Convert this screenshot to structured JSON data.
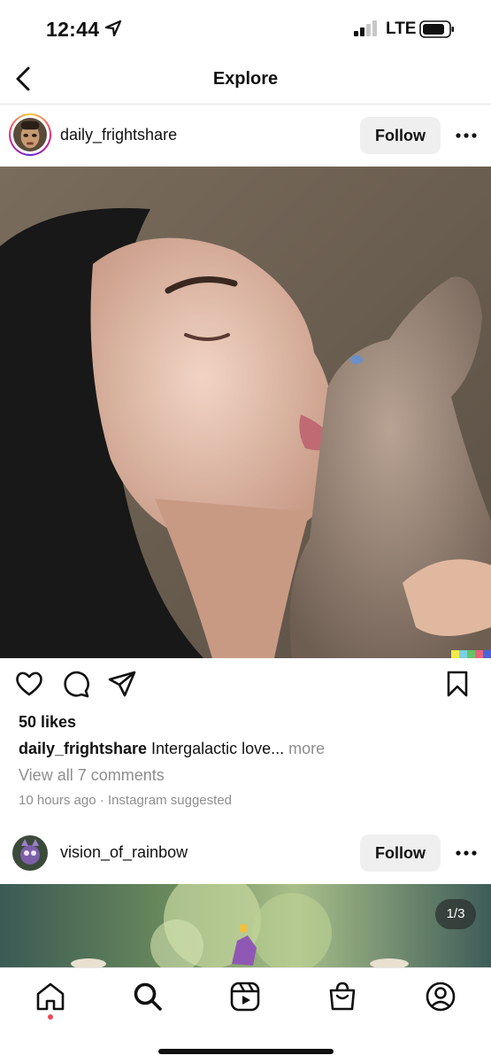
{
  "status_bar": {
    "time": "12:44",
    "network": "LTE"
  },
  "header": {
    "title": "Explore"
  },
  "posts": [
    {
      "username": "daily_frightshare",
      "follow_label": "Follow",
      "likes": "50 likes",
      "caption_user": "daily_frightshare",
      "caption_text": " Intergalactic love...",
      "caption_more": " more",
      "view_comments": "View all 7 comments",
      "time_ago": "10 hours ago",
      "separator": " · ",
      "suggestion": "Instagram suggested"
    },
    {
      "username": "vision_of_rainbow",
      "follow_label": "Follow",
      "image_counter": "1/3"
    }
  ],
  "icons": {
    "back": "chevron-left-icon",
    "more": "more-horizontal-icon",
    "like": "heart-icon",
    "comment": "comment-icon",
    "share": "send-icon",
    "save": "bookmark-icon",
    "tabs": [
      "home-icon",
      "search-icon",
      "reels-icon",
      "shop-icon",
      "profile-icon"
    ]
  },
  "colors": {
    "notification_dot": "#ed4956",
    "follow_bg": "#efefef",
    "muted_text": "#8e8e8e"
  }
}
